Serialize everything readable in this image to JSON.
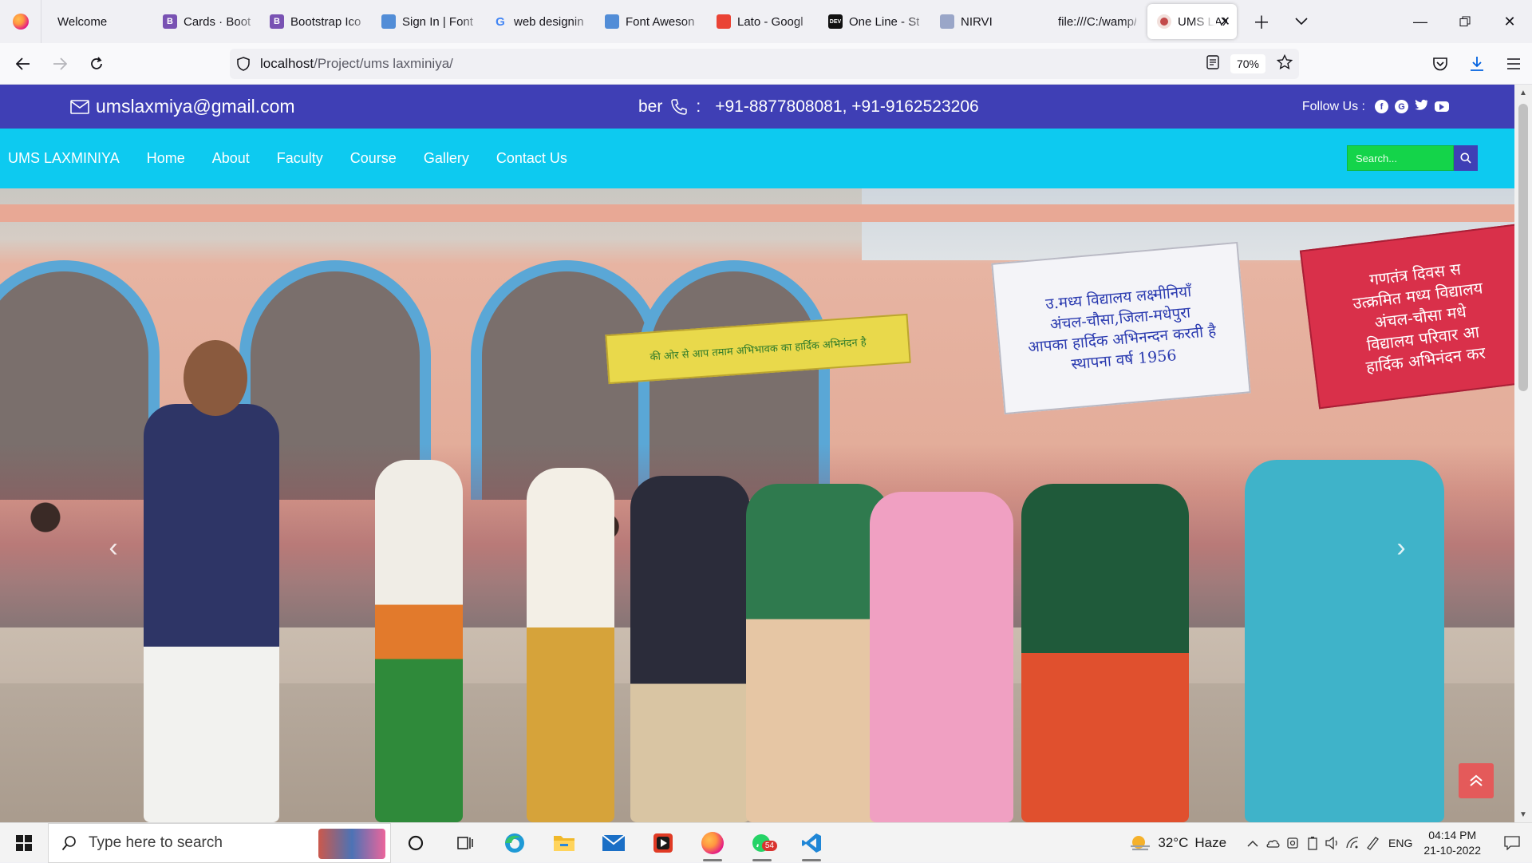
{
  "browser": {
    "tabs": [
      {
        "label": "Welcome",
        "icon": "blank-page-icon",
        "color": "#f0f0f4"
      },
      {
        "label": "Cards · Boots",
        "icon": "bootstrap-icon",
        "color": "#7952b3",
        "glyph": "B"
      },
      {
        "label": "Bootstrap Ico",
        "icon": "bootstrap-icon",
        "color": "#7952b3",
        "glyph": "B"
      },
      {
        "label": "Sign In | Font",
        "icon": "fontawesome-flag-icon",
        "color": "#528dd7",
        "glyph": ""
      },
      {
        "label": "web designin",
        "icon": "google-icon",
        "color": "#4285f4",
        "glyph": "G"
      },
      {
        "label": "Font Aweson",
        "icon": "fontawesome-flag-icon",
        "color": "#528dd7",
        "glyph": ""
      },
      {
        "label": "Lato - Googl",
        "icon": "google-fonts-icon",
        "color": "#ea4335",
        "glyph": ""
      },
      {
        "label": "One Line - St",
        "icon": "dev-icon",
        "color": "#111111",
        "glyph": "DEV"
      },
      {
        "label": "NIRVI",
        "icon": "nirvi-icon",
        "color": "#9aa6c8",
        "glyph": ""
      },
      {
        "label": "file:///C:/wamp/v",
        "icon": "file-icon",
        "color": "#f0f0f4",
        "glyph": ""
      }
    ],
    "active_tab": {
      "label": "UMS LAXN",
      "icon": "school-logo-icon"
    },
    "url_host": "localhost",
    "url_path": "/Project/ums laxminiya/",
    "zoom": "70%"
  },
  "site": {
    "email": "umslaxmiya@gmail.com",
    "phone_prefix": "ber",
    "phone_sep": ":",
    "phones": "+91-8877808081,  +91-9162523206",
    "follow_label": "Follow  Us  :",
    "social_icons": [
      "facebook-icon",
      "google-icon",
      "twitter-icon",
      "youtube-icon"
    ],
    "brand": "UMS LAXMINIYA",
    "nav": [
      "Home",
      "About",
      "Faculty",
      "Course",
      "Gallery",
      "Contact Us"
    ],
    "search_placeholder": "Search...",
    "colors": {
      "topbar": "#3f3fb5",
      "navbar": "#0dcaf0",
      "search_field": "#14d44a",
      "back_to_top": "#e45a5a"
    }
  },
  "carousel": {
    "banners": [
      {
        "text": "उ.मध्य विद्यालय लक्ष्मीनियाँ\nअंचल-चौसा,जिला-मधेपुरा\nआपका हार्दिक अभिनन्दन करती है\nस्थापना वर्ष 1956"
      },
      {
        "text": "गणतंत्र दिवस स\nउत्क्रमित मध्य विद्यालय\nअंचल-चौसा मधे\nविद्यालय परिवार आ\nहार्दिक अभिनंदन कर"
      },
      {
        "text": "की ओर से आप तमाम अभिभावक का हार्दिक अभिनंदन है"
      }
    ]
  },
  "taskbar": {
    "search_placeholder": "Type here to search",
    "apps": [
      "task-view-icon",
      "edge-icon",
      "file-explorer-icon",
      "mail-icon",
      "media-player-icon",
      "firefox-icon",
      "whatsapp-icon",
      "vscode-icon"
    ],
    "whatsapp_badge": "54",
    "weather_temp": "32°C",
    "weather_text": "Haze",
    "language": "ENG",
    "time": "04:14 PM",
    "date": "21-10-2022"
  }
}
